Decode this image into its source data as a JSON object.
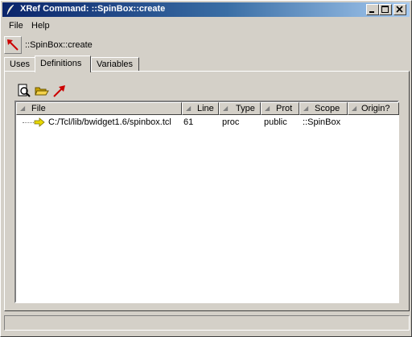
{
  "window": {
    "title": "XRef Command: ::SpinBox::create",
    "controls": {
      "minimize": "minimize-icon",
      "maximize": "maximize-icon",
      "close": "close-icon"
    }
  },
  "menu": [
    "File",
    "Help"
  ],
  "command": {
    "label": "::SpinBox::create",
    "icon": "goto-arrow-icon"
  },
  "tabs": [
    {
      "label": "Uses",
      "active": false
    },
    {
      "label": "Definitions",
      "active": true
    },
    {
      "label": "Variables",
      "active": false
    }
  ],
  "toolbar": {
    "icons": [
      "find-icon",
      "open-folder-icon",
      "goto-arrow-icon"
    ]
  },
  "table": {
    "columns": [
      "File",
      "Line",
      "Type",
      "Prot",
      "Scope",
      "Origin?"
    ],
    "rows": [
      {
        "file": "C:/Tcl/lib/bwidget1.6/spinbox.tcl",
        "line": "61",
        "type": "proc",
        "prot": "public",
        "scope": "::SpinBox",
        "origin": ""
      }
    ]
  },
  "colors": {
    "titlebar_start": "#0a246a",
    "titlebar_end": "#a6caf0",
    "face": "#d4d0c8",
    "arrow_red": "#cc0000",
    "row_arrow_yellow": "#e8d800"
  }
}
